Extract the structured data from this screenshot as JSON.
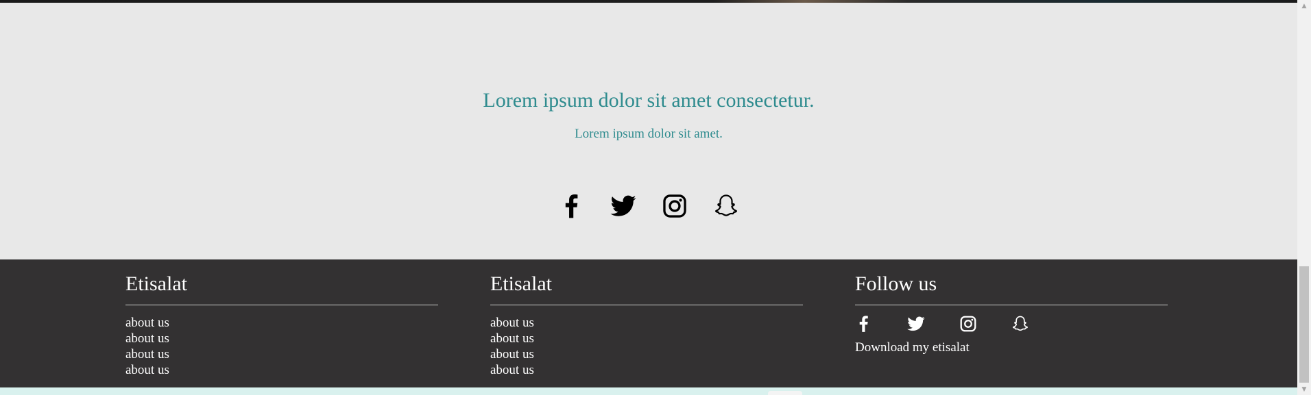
{
  "hero": {
    "title": "Lorem ipsum dolor sit amet consectetur.",
    "subtitle": "Lorem ipsum dolor sit amet.",
    "social_icons": [
      "facebook-icon",
      "twitter-icon",
      "instagram-icon",
      "snapchat-icon"
    ]
  },
  "footer": {
    "columns": [
      {
        "heading": "Etisalat",
        "links": [
          "about us",
          "about us",
          "about us",
          "about us"
        ]
      },
      {
        "heading": "Etisalat",
        "links": [
          "about us",
          "about us",
          "about us",
          "about us"
        ]
      }
    ],
    "follow": {
      "heading": "Follow us",
      "social_icons": [
        "facebook-icon",
        "twitter-icon",
        "instagram-icon",
        "snapchat-icon"
      ],
      "download_label": "Download my etisalat"
    }
  },
  "colors": {
    "accent": "#2e8b8e",
    "hero_background": "#e8e8e8",
    "footer_background": "#333132",
    "footer_text": "#ffffff"
  }
}
